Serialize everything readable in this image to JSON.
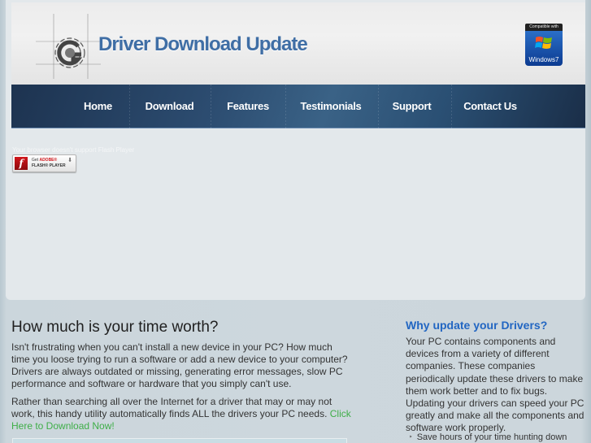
{
  "header": {
    "logo_text": "Driver Download Update",
    "badge": {
      "top_text": "Compatible with",
      "label": "Windows7"
    }
  },
  "nav": {
    "items": [
      {
        "label": "Home"
      },
      {
        "label": "Download"
      },
      {
        "label": "Features"
      },
      {
        "label": "Testimonials"
      },
      {
        "label": "Support"
      },
      {
        "label": "Contact Us"
      }
    ]
  },
  "flash": {
    "message": "Your browser doesn't support Flash Player",
    "button_line1_prefix": "Get",
    "button_line1_brand": "ADOBE®",
    "button_line2": "FLASH® PLAYER",
    "logo_glyph": "f"
  },
  "main": {
    "heading": "How much is your time worth?",
    "paragraph1": "Isn't frustrating when you can't install a new device in your PC? How much time you loose trying to run a software or add a new device to your computer? Drivers are always outdated or missing, generating error messages, slow PC performance and software or hardware that you simply can't use.",
    "paragraph2": "Rather than searching all over the Internet for a driver that may or may not work, this handy utility automatically finds ALL the drivers your PC needs.",
    "cta_link": "Click Here to Download Now!"
  },
  "sidebar": {
    "heading": "Why update your Drivers?",
    "paragraph": "Your PC contains components and devices from a variety of different companies. These companies periodically update these drivers to make them work better and to fix bugs. Updating your drivers can speed your PC greatly and make all the components and software work properly.",
    "bullets": [
      "Save hours of your time hunting down"
    ]
  },
  "colors": {
    "logo_blue": "#3f6ea5",
    "nav_dark": "#1d3350",
    "sidebar_heading": "#2266c2",
    "cta_green": "#3fae48",
    "flash_red": "#d1161b"
  }
}
